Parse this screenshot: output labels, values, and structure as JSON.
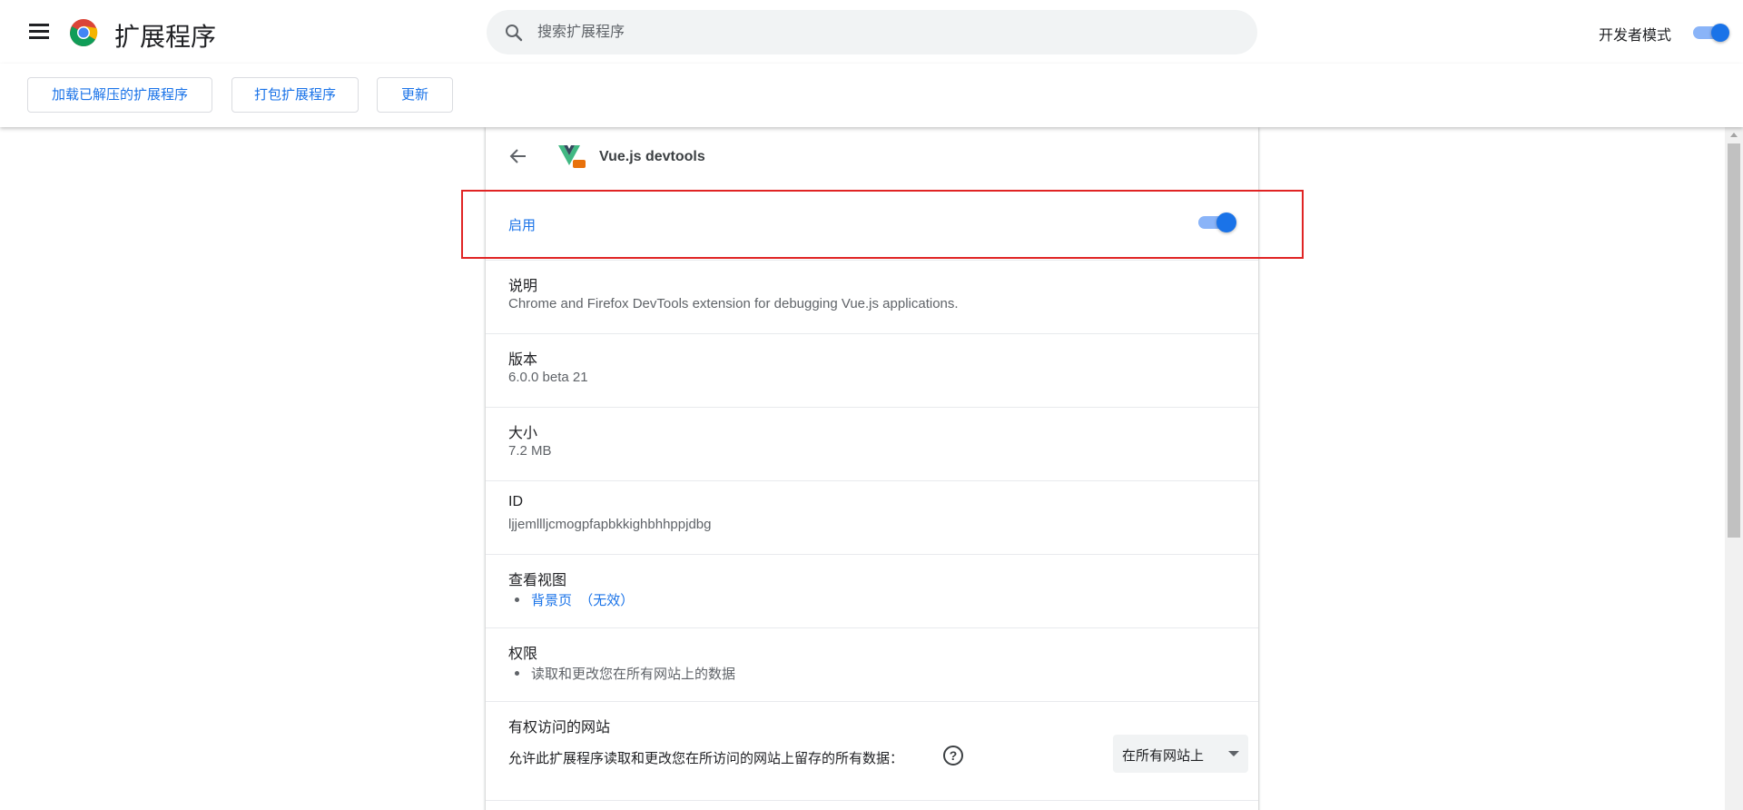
{
  "toolbar": {
    "title": "扩展程序",
    "search_placeholder": "搜索扩展程序",
    "dev_mode_label": "开发者模式",
    "dev_mode_on": true
  },
  "devbar": {
    "load_unpacked": "加载已解压的扩展程序",
    "pack": "打包扩展程序",
    "update": "更新"
  },
  "extension": {
    "name": "Vue.js devtools",
    "enable_label": "启用",
    "enabled": true,
    "sections": {
      "description": {
        "label": "说明",
        "value": "Chrome and Firefox DevTools extension for debugging Vue.js applications."
      },
      "version": {
        "label": "版本",
        "value": "6.0.0 beta 21"
      },
      "size": {
        "label": "大小",
        "value": "7.2 MB"
      },
      "id": {
        "label": "ID",
        "value": "ljjemllljcmogpfapbkkighbhhppjdbg"
      },
      "views": {
        "label": "查看视图",
        "link": "背景页",
        "note": "（无效）"
      },
      "permissions": {
        "label": "权限",
        "item": "读取和更改您在所有网站上的数据"
      },
      "site_access": {
        "label": "有权访问的网站",
        "prompt": "允许此扩展程序读取和更改您在所访问的网站上留存的所有数据：",
        "selected": "在所有网站上"
      }
    }
  },
  "colors": {
    "accent": "#1a73e8",
    "highlight": "#e02424",
    "toggle_track": "#8ab4f8"
  },
  "icons": [
    "hamburger-menu-icon",
    "chrome-logo-icon",
    "search-icon",
    "back-arrow-icon",
    "vue-logo-icon",
    "help-icon",
    "dropdown-arrow-icon"
  ]
}
